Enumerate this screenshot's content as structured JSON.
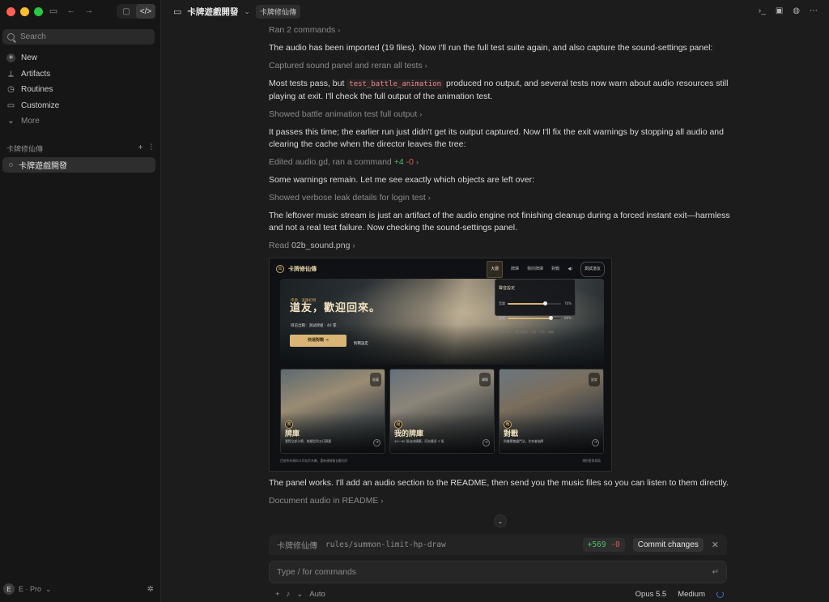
{
  "sidebar": {
    "search_placeholder": "Search",
    "nav": [
      {
        "label": "New",
        "icon": "plus-circle-icon"
      },
      {
        "label": "Artifacts",
        "icon": "artifacts-icon"
      },
      {
        "label": "Routines",
        "icon": "clock-icon"
      },
      {
        "label": "Customize",
        "icon": "briefcase-icon"
      },
      {
        "label": "More",
        "icon": "chevron-down-icon"
      }
    ],
    "project_title": "卡牌修仙傳",
    "threads": [
      {
        "label": "卡牌遊戲開發"
      }
    ],
    "user": {
      "initial": "E",
      "label": "E · Pro"
    }
  },
  "header": {
    "title": "卡牌遊戲開發",
    "project_badge": "卡牌修仙傳"
  },
  "chat": {
    "messages": [
      {
        "kind": "tool",
        "text": "Ran 2 commands"
      },
      {
        "kind": "text",
        "text": "The audio has been imported (19 files). Now I'll run the full test suite again, and also capture the sound-settings panel:"
      },
      {
        "kind": "tool",
        "text": "Captured sound panel and reran all tests"
      },
      {
        "kind": "text_code",
        "before": "Most tests pass, but ",
        "code": "test_battle_animation",
        "after": " produced no output, and several tests now warn about audio resources still playing at exit. I'll check the full output of the animation test."
      },
      {
        "kind": "tool",
        "text": "Showed battle animation test full output"
      },
      {
        "kind": "text",
        "text": "It passes this time; the earlier run just didn't get its output captured. Now I'll fix the exit warnings by stopping all audio and clearing the cache when the director leaves the tree:"
      },
      {
        "kind": "tool_diff",
        "text": "Edited audio.gd, ran a command",
        "plus": "+4",
        "minus": "-0"
      },
      {
        "kind": "text",
        "text": "Some warnings remain. Let me see exactly which objects are left over:"
      },
      {
        "kind": "tool",
        "text": "Showed verbose leak details for login test"
      },
      {
        "kind": "text",
        "text": "The leftover music stream is just an artifact of the audio engine not finishing cleanup during a forced instant exit—harmless and not a real test failure. Now checking the sound-settings panel."
      },
      {
        "kind": "tool_read",
        "prefix": "Read",
        "file": "02b_sound.png"
      }
    ],
    "after_image": [
      {
        "kind": "text",
        "text": "The panel works. I'll add an audio section to the README, then send you the music files so you can listen to them directly."
      },
      {
        "kind": "tool",
        "text": "Document audio in README"
      }
    ]
  },
  "screenshot": {
    "brand": "卡牌修仙傳",
    "logo_char": "仙",
    "nav": [
      "大廳",
      "牌庫",
      "我的牌庫",
      "對戰"
    ],
    "user": "測試道友",
    "hero_tag": "序章 · 道韻初現",
    "hero_title": "道友，歡迎回來。",
    "hero_sub": "目前出戰：測試牌組 · 40 張",
    "hero_button": "快速對戰 →",
    "hero_button2": "對戰設定",
    "sound_panel": {
      "title": "聲音設定",
      "rows": [
        {
          "label": "音樂",
          "value": 0.7,
          "text": "70%"
        },
        {
          "label": "音效",
          "value": 0.8,
          "text": "80%"
        }
      ],
      "footer": "音樂來源：（遊山問道）· 大廳 ·（鬥法）· 對戰"
    },
    "cards": [
      {
        "seal": "典",
        "name": "牌庫",
        "desc": "瀏覽全部卡牌，依類型與五行篩選",
        "corner": "收藏"
      },
      {
        "seal": "組",
        "name": "我的牌庫",
        "desc": "40～60 張自由構築，同名最多 3 張",
        "corner": "構築"
      },
      {
        "seal": "戰",
        "name": "對戰",
        "desc": "與機關傀儡鬥法，先攻者抽牌",
        "corner": "對弈"
      }
    ],
    "footer_left": "目前所有資料卡均存於本機，重新連線後自動同步",
    "footer_right": "規則書與幫助"
  },
  "branch_bar": {
    "project": "卡牌修仙傳",
    "branch": "rules/summon-limit-hp-draw",
    "plus": "+569",
    "minus": "-0",
    "commit_label": "Commit changes"
  },
  "composer": {
    "placeholder": "Type / for commands",
    "mode": "Auto",
    "model": "Opus 5.5",
    "effort": "Medium"
  },
  "colors": {
    "accent_gold": "#d8b577",
    "diff_plus": "#4fbf6a",
    "diff_minus": "#e05858"
  }
}
